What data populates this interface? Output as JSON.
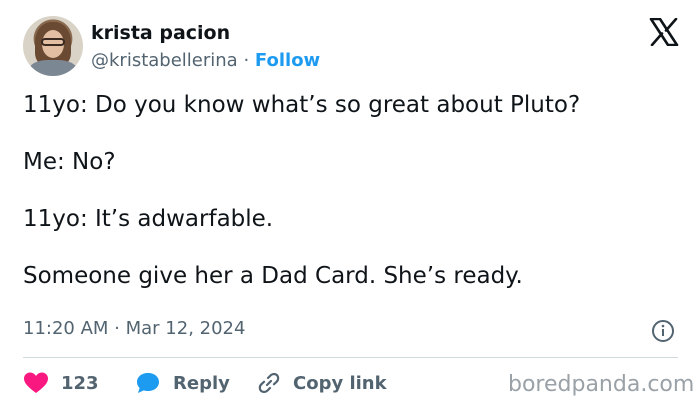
{
  "author": {
    "display_name": "krista pacion",
    "handle": "@kristabellerina",
    "separator": "·",
    "follow_label": "Follow"
  },
  "tweet": {
    "lines": [
      "11yo: Do you know what’s so great about Pluto?",
      "Me: No?",
      "11yo: It’s adwarfable.",
      "Someone give her a Dad Card. She’s ready."
    ],
    "timestamp": "11:20 AM · Mar 12, 2024"
  },
  "actions": {
    "like_count": "123",
    "reply_label": "Reply",
    "copy_link_label": "Copy link"
  },
  "watermark": "boredpanda.com",
  "colors": {
    "accent": "#1d9bf0",
    "like": "#f91880",
    "text": "#0f1419",
    "secondary": "#536471"
  },
  "icons": [
    "x-logo-icon",
    "info-icon",
    "heart-icon",
    "reply-bubble-icon",
    "link-icon"
  ]
}
